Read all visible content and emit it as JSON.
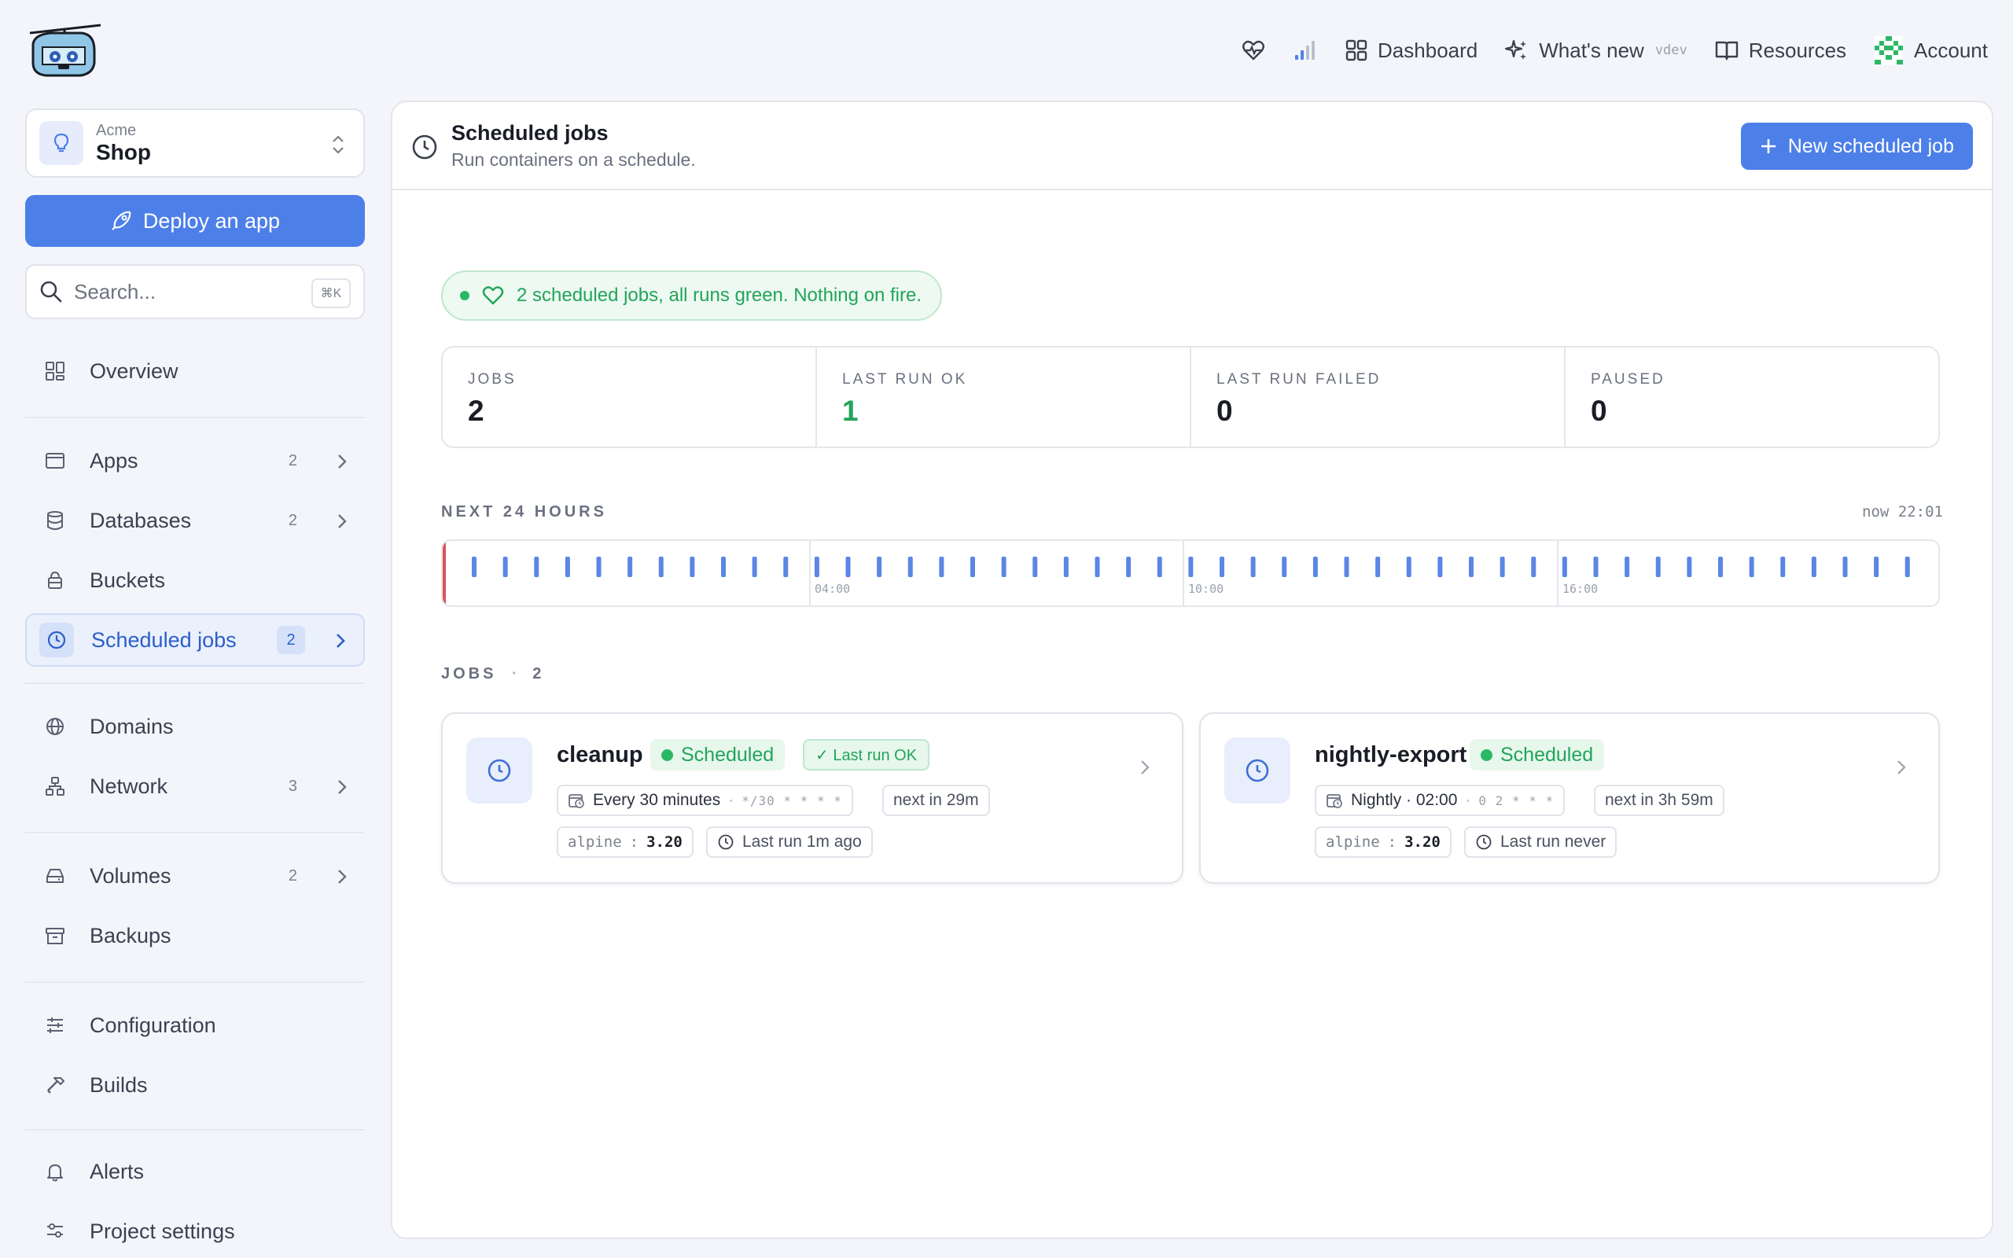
{
  "topnav": {
    "dashboard": "Dashboard",
    "whats_new": "What's new",
    "version_tag": "vdev",
    "resources": "Resources",
    "account": "Account"
  },
  "project": {
    "org": "Acme",
    "name": "Shop"
  },
  "deploy_label": "Deploy an app",
  "search": {
    "placeholder": "Search...",
    "shortcut": "⌘K"
  },
  "sidebar": {
    "items": [
      {
        "label": "Overview",
        "icon": "grid-icon"
      },
      {
        "label": "Apps",
        "count": "2",
        "icon": "window-icon"
      },
      {
        "label": "Databases",
        "count": "2",
        "icon": "database-icon"
      },
      {
        "label": "Buckets",
        "icon": "bucket-icon"
      },
      {
        "label": "Scheduled jobs",
        "count": "2",
        "icon": "clock-icon",
        "active": true
      },
      {
        "label": "Domains",
        "icon": "globe-icon"
      },
      {
        "label": "Network",
        "count": "3",
        "icon": "network-icon"
      },
      {
        "label": "Volumes",
        "count": "2",
        "icon": "drive-icon"
      },
      {
        "label": "Backups",
        "icon": "archive-icon"
      },
      {
        "label": "Configuration",
        "icon": "sliders-icon"
      },
      {
        "label": "Builds",
        "icon": "hammer-icon"
      },
      {
        "label": "Alerts",
        "icon": "bell-icon"
      },
      {
        "label": "Project settings",
        "icon": "settings-icon"
      }
    ]
  },
  "page": {
    "title": "Scheduled jobs",
    "subtitle": "Run containers on a schedule.",
    "new_button": "New scheduled job"
  },
  "health_banner": "2 scheduled jobs, all runs green. Nothing on fire.",
  "stats": [
    {
      "label": "JOBS",
      "value": "2"
    },
    {
      "label": "LAST RUN OK",
      "value": "1"
    },
    {
      "label": "LAST RUN FAILED",
      "value": "0"
    },
    {
      "label": "PAUSED",
      "value": "0"
    }
  ],
  "timeline": {
    "heading": "NEXT 24 HOURS",
    "now_label": "now 22:01",
    "hour_labels": [
      "04:00",
      "10:00",
      "16:00"
    ],
    "colors": {
      "tick": "#5b86e5",
      "now": "#e0525a"
    }
  },
  "jobs_heading": {
    "label": "JOBS",
    "sep": "·",
    "count": "2"
  },
  "jobs": [
    {
      "name": "cleanup",
      "status": "Scheduled",
      "last_run_badge": "✓ Last run OK",
      "schedule": "Every 30 minutes",
      "sep": "·",
      "cron": "*/30 * * * *",
      "next": "next in 29m",
      "image": "alpine",
      "image_sep": ":",
      "tag": "3.20",
      "last_run": "Last run 1m ago"
    },
    {
      "name": "nightly-export",
      "status": "Scheduled",
      "schedule": "Nightly · 02:00",
      "sep": "·",
      "cron": "0 2 * * *",
      "next": "next in 3h 59m",
      "image": "alpine",
      "image_sep": ":",
      "tag": "3.20",
      "last_run": "Last run never"
    }
  ],
  "colors": {
    "accent": "#4d7fe8",
    "success": "#22a45a",
    "active_nav": "#2c5ec8"
  }
}
